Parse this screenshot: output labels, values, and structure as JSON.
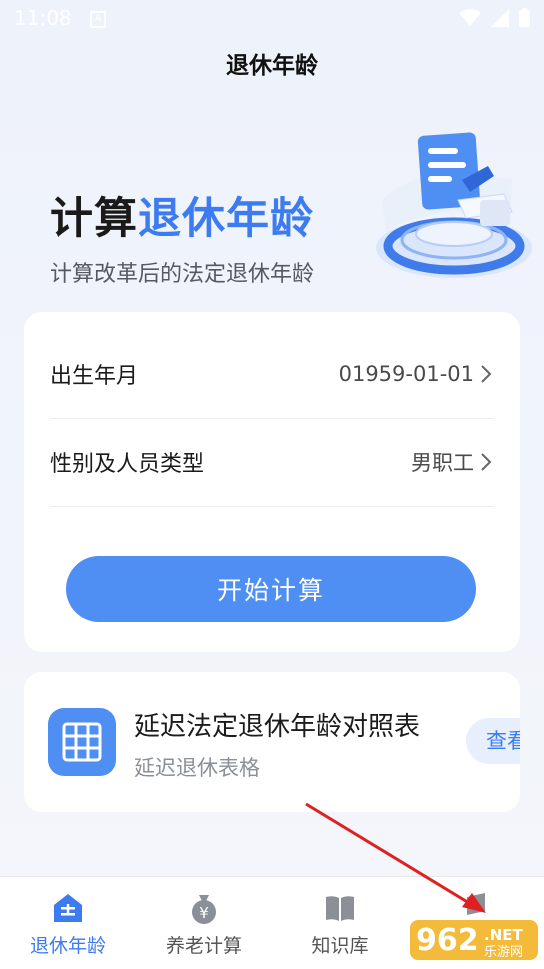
{
  "status_bar": {
    "time": "11:08",
    "notification_letter": "A"
  },
  "header": {
    "title": "退休年龄"
  },
  "hero": {
    "title_plain": "计算",
    "title_accent": "退休年龄",
    "subtitle": "计算改革后的法定退休年龄",
    "illustration_icon": "document-ring-illustration"
  },
  "form": {
    "birth": {
      "label": "出生年月",
      "value": "01959-01-01"
    },
    "type": {
      "label": "性别及人员类型",
      "value": "男职工"
    },
    "start_button": "开始计算"
  },
  "table_card": {
    "title": "延迟法定退休年龄对照表",
    "subtitle": "延迟退休表格",
    "view_button": "查看",
    "icon": "grid-table-icon"
  },
  "tabs": [
    {
      "label": "退休年龄",
      "icon": "home-calculator-icon",
      "active": true
    },
    {
      "label": "养老计算",
      "icon": "money-bag-icon",
      "active": false
    },
    {
      "label": "知识库",
      "icon": "book-icon",
      "active": false
    },
    {
      "label": "",
      "icon": "user-icon",
      "active": false
    }
  ],
  "watermark": {
    "text_main": "962",
    "text_net": ".NET",
    "text_sub": "乐游网"
  },
  "colors": {
    "accent": "#3d7cf0",
    "button": "#4f8ff4",
    "annotation_arrow": "#e02020"
  }
}
